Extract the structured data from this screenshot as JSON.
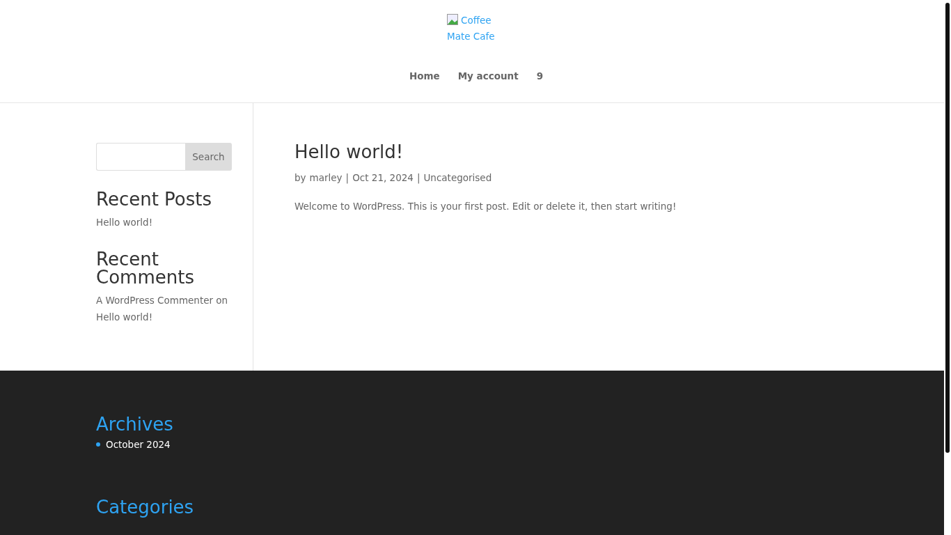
{
  "header": {
    "logo_alt": "Coffee Mate Cafe",
    "nav": [
      {
        "label": "Home"
      },
      {
        "label": "My account"
      },
      {
        "label": "9"
      }
    ]
  },
  "sidebar": {
    "search": {
      "button": "Search"
    },
    "widgets": [
      {
        "title": "Recent Posts",
        "lines": [
          "Hello world!"
        ]
      },
      {
        "title": "Recent Comments",
        "lines": [
          "A WordPress Commenter on Hello world!"
        ]
      }
    ]
  },
  "post": {
    "title": "Hello world!",
    "by": "by",
    "author": "marley",
    "separators": [
      "|",
      "|"
    ],
    "date": "Oct 21, 2024",
    "category": "Uncategorised",
    "body": "Welcome to WordPress. This is your first post. Edit or delete it, then start writing!"
  },
  "footer": {
    "widgets": [
      {
        "title": "Archives",
        "items": [
          "October 2024"
        ]
      },
      {
        "title": "Categories"
      }
    ]
  }
}
